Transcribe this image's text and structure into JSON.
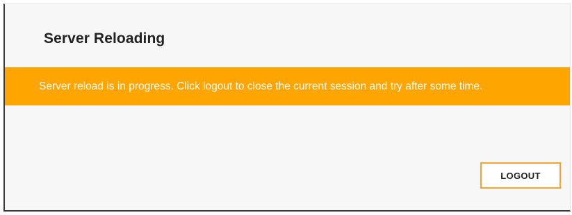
{
  "dialog": {
    "title": "Server Reloading",
    "message": "Server reload is in progress. Click logout to close the current session and try after some time.",
    "logout_label": "LOGOUT",
    "banner_color": "#ffa500",
    "button_border_color": "#f0a530"
  }
}
